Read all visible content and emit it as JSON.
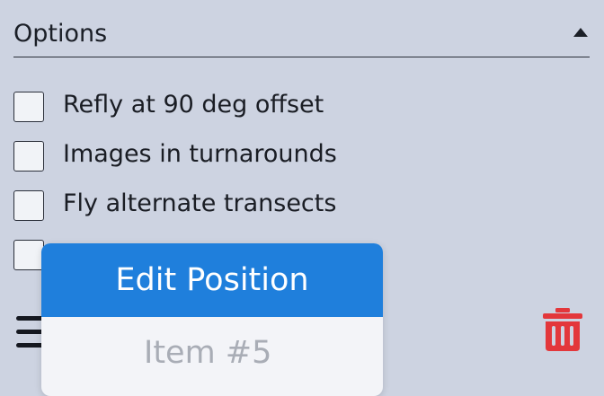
{
  "options_section": {
    "title": "Options",
    "items": [
      {
        "label": "Refly at 90 deg offset",
        "checked": false
      },
      {
        "label": "Images in turnarounds",
        "checked": false
      },
      {
        "label": "Fly alternate transects",
        "checked": false
      },
      {
        "label": "",
        "checked": false
      }
    ]
  },
  "popup_menu": {
    "items": [
      {
        "label": "Edit Position",
        "state": "highlighted"
      },
      {
        "label": "Item #5",
        "state": "disabled"
      }
    ]
  },
  "icons": {
    "collapse": "chevron-up-icon",
    "menu": "hamburger-menu-icon",
    "delete": "trash-icon"
  },
  "colors": {
    "background": "#cdd3e1",
    "accent": "#1f7fdc",
    "delete": "#e3373b"
  }
}
